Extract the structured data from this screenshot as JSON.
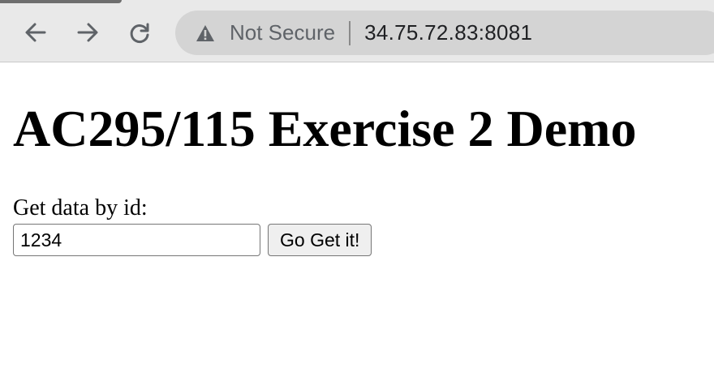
{
  "browser": {
    "icons": {
      "back": "back-arrow-icon",
      "forward": "forward-arrow-icon",
      "reload": "reload-icon",
      "security": "warning-triangle-icon"
    },
    "security_label": "Not Secure",
    "url": "34.75.72.83:8081"
  },
  "page": {
    "title": "AC295/115 Exercise 2 Demo",
    "form": {
      "label": "Get data by id:",
      "input_value": "1234",
      "button_label": "Go Get it!"
    }
  },
  "colors": {
    "toolbar_bg": "#e9e9e9",
    "omnibox_bg": "#d4d4d4",
    "page_bg": "#ffffff"
  }
}
